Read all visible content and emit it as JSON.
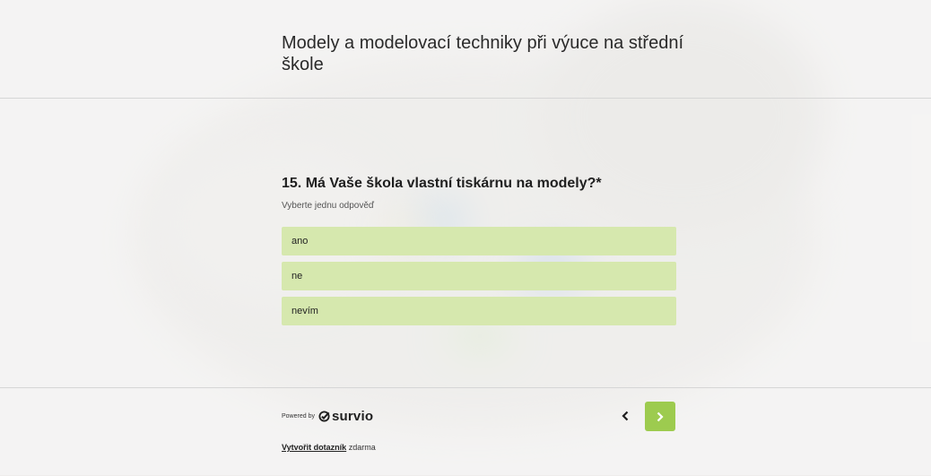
{
  "survey": {
    "title": "Modely a modelovací techniky při výuce na střední škole"
  },
  "question": {
    "title": "15. Má Vaše škola vlastní tiskárnu na modely?*",
    "hint": "Vyberte jednu odpověď",
    "options": [
      "ano",
      "ne",
      "nevím"
    ]
  },
  "footer": {
    "powered_by": "Powered by",
    "brand": "survio",
    "create_link": "Vytvořit dotazník",
    "create_suffix": "zdarma"
  },
  "nav": {
    "prev_icon": "chevron-left-icon",
    "next_icon": "chevron-right-icon"
  },
  "colors": {
    "option_bg": "#d6e8ae",
    "next_button": "#9dcb4f",
    "divider": "#d6d6d6"
  }
}
